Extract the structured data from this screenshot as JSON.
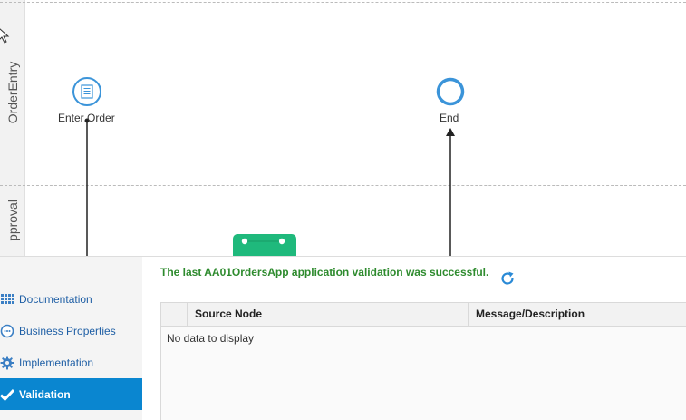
{
  "canvas": {
    "lanes": [
      {
        "label": "OrderEntry"
      },
      {
        "label": "pproval"
      }
    ],
    "nodes": {
      "enter_order": {
        "label": "Enter Order",
        "icon": "form-task-icon"
      },
      "end": {
        "label": "End",
        "icon": "end-event-icon"
      },
      "approval_task": {
        "icon": "human-task-icon",
        "color": "#1fb97c"
      }
    },
    "colors": {
      "node_stroke": "#3b94d9",
      "flow": "#222222"
    }
  },
  "panel": {
    "nav": [
      {
        "label": "Documentation",
        "icon": "document-grid-icon"
      },
      {
        "label": "Business Properties",
        "icon": "speech-bubble-icon"
      },
      {
        "label": "Implementation",
        "icon": "gear-icon"
      },
      {
        "label": "Validation",
        "icon": "checkmark-icon",
        "active": true
      }
    ],
    "message": "The last AA01OrdersApp application validation was successful.",
    "refresh_icon": "refresh-icon",
    "table": {
      "columns": [
        "Source Node",
        "Message/Description"
      ],
      "empty_text": "No data to display"
    },
    "colors": {
      "success": "#2e8b2e",
      "active_nav": "#0a86d0",
      "link": "#1f5fa5"
    }
  }
}
